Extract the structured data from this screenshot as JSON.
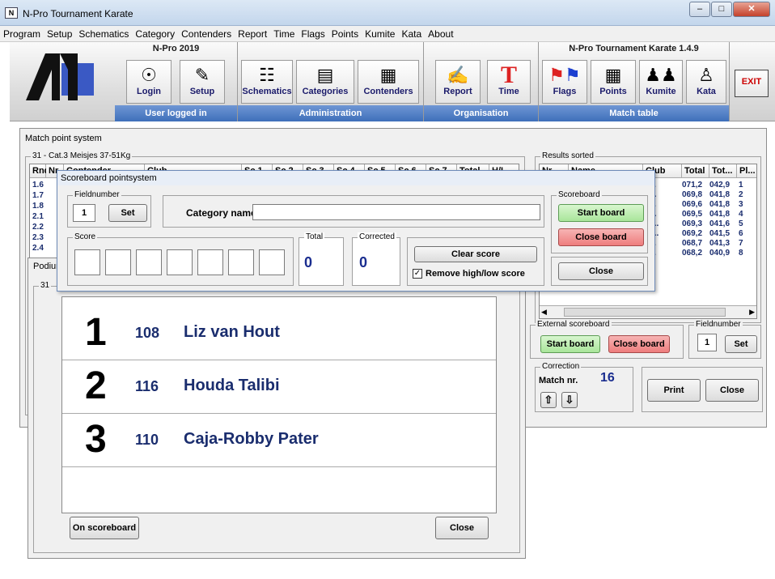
{
  "window": {
    "title": "N-Pro Tournament Karate",
    "icon_text": "N"
  },
  "menu": [
    "Program",
    "Setup",
    "Schematics",
    "Category",
    "Contenders",
    "Report",
    "Time",
    "Flags",
    "Points",
    "Kumite",
    "Kata",
    "About"
  ],
  "ribbon": {
    "group1": {
      "title": "N-Pro 2019",
      "footer": "User logged in",
      "buttons": [
        "Login",
        "Setup"
      ]
    },
    "group2": {
      "footer": "Administration",
      "buttons": [
        "Schematics",
        "Categories",
        "Contenders"
      ]
    },
    "group3": {
      "footer": "Organisation",
      "buttons": [
        "Report",
        "Time"
      ]
    },
    "group4": {
      "title": "N-Pro Tournament Karate 1.4.9",
      "footer": "Match table",
      "buttons": [
        "Flags",
        "Points",
        "Kumite",
        "Kata"
      ]
    },
    "exit": "EXIT"
  },
  "main": {
    "title": "Match point system",
    "category_legend": "31  -  Cat.3 Meisjes 37-51Kg",
    "table_headers": [
      "Rnd",
      "Nr",
      "Contender",
      "Club",
      "Sc 1",
      "Sc 2",
      "Sc 3",
      "Sc 4",
      "Sc 5",
      "Sc 6",
      "Sc 7",
      "Total",
      "H/L"
    ],
    "rounds": [
      "1.6",
      "1.7",
      "1.8",
      "2.1",
      "2.2",
      "2.3",
      "2.4"
    ],
    "results_legend": "Results sorted",
    "results_headers": [
      "Nr",
      "Name",
      "Club",
      "Total",
      "Tot...",
      "Pl..."
    ],
    "results": [
      {
        "club": "a...",
        "total": "071,2",
        "tot": "042,9",
        "pl": "1"
      },
      {
        "club": "b...",
        "total": "069,8",
        "tot": "041,8",
        "pl": "2"
      },
      {
        "club": "a...",
        "total": "069,6",
        "tot": "041,8",
        "pl": "3"
      },
      {
        "club": "o...",
        "total": "069,5",
        "tot": "041,8",
        "pl": "4"
      },
      {
        "club": "at...",
        "total": "069,3",
        "tot": "041,6",
        "pl": "5"
      },
      {
        "club": "at...",
        "total": "069,2",
        "tot": "041,5",
        "pl": "6"
      },
      {
        "club": "e...",
        "total": "068,7",
        "tot": "041,3",
        "pl": "7"
      },
      {
        "club": "a...",
        "total": "068,2",
        "tot": "040,9",
        "pl": "8"
      }
    ],
    "external_legend": "External scoreboard",
    "start_board": "Start board",
    "close_board": "Close board",
    "fieldnumber_legend": "Fieldnumber",
    "fieldnumber": "1",
    "set": "Set",
    "correction_legend": "Correction",
    "match_nr_label": "Match nr.",
    "match_nr": "16",
    "print": "Print",
    "close": "Close"
  },
  "dialog": {
    "title": "Scoreboard pointsystem",
    "fieldnumber_legend": "Fieldnumber",
    "fieldnumber": "1",
    "set": "Set",
    "category_label": "Category name",
    "category_value": "",
    "score_legend": "Score",
    "total_legend": "Total",
    "total": "0",
    "corrected_legend": "Corrected",
    "corrected": "0",
    "clear_score": "Clear score",
    "remove_hl": "Remove high/low score",
    "scoreboard_legend": "Scoreboard",
    "start_board": "Start board",
    "close_board": "Close board",
    "close": "Close"
  },
  "podium": {
    "title": "Podium",
    "legend": "31",
    "places": [
      {
        "rank": "1",
        "nr": "108",
        "name": "Liz van Hout"
      },
      {
        "rank": "2",
        "nr": "116",
        "name": "Houda Talibi"
      },
      {
        "rank": "3",
        "nr": "110",
        "name": "Caja-Robby Pater"
      }
    ],
    "on_scoreboard": "On scoreboard",
    "close": "Close"
  }
}
